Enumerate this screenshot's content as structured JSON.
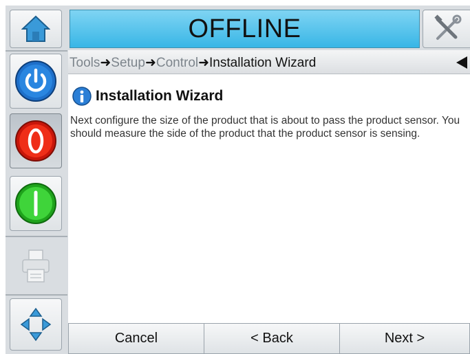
{
  "header": {
    "status_text": "OFFLINE"
  },
  "breadcrumb": {
    "items": [
      "Tools",
      "Setup",
      "Control"
    ],
    "separator": "➜",
    "current": "Installation Wizard"
  },
  "content": {
    "title": "Installation Wizard",
    "message": "Next configure the size of the product that is about to pass the product sensor. You should measure the side of the product that the product sensor is sensing."
  },
  "footer": {
    "cancel_label": "Cancel",
    "back_label": "< Back",
    "next_label": "Next >"
  },
  "icons": {
    "home": "home-icon",
    "tools": "tools-icon",
    "power": "power-icon",
    "stop": "stop-icon",
    "start": "start-icon",
    "printer": "printer-icon",
    "navigate": "navigation-arrows-icon",
    "info": "info-icon",
    "back": "back-triangle-icon"
  },
  "colors": {
    "status_bar": "#38b6e6",
    "power": "#1e6fc9",
    "stop": "#e02010",
    "start": "#2ec82a"
  }
}
